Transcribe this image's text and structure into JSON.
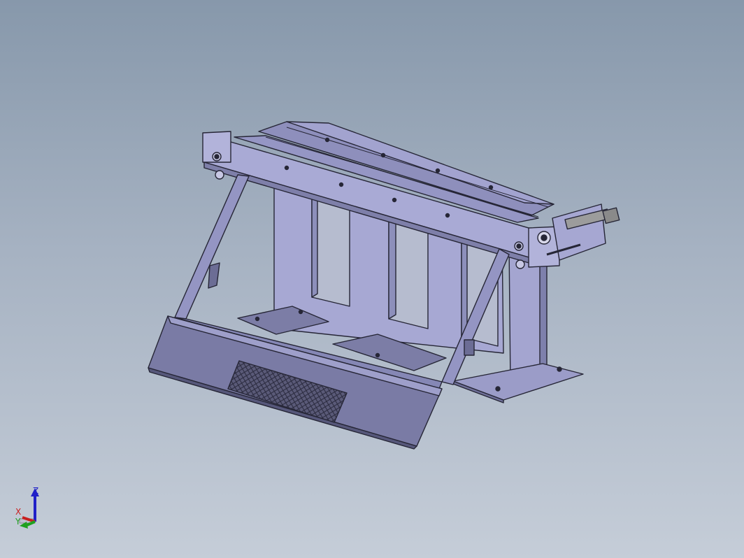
{
  "viewport": {
    "background_top": "#8798ab",
    "background_bottom": "#c5cdd8",
    "model_color": "#9fa0cc",
    "edge_color": "#262636"
  },
  "triad": {
    "z_label": "Z",
    "x_label": "X",
    "y_label": "Y",
    "z_color": "#2020c8",
    "x_color": "#c82020",
    "y_color": "#20a020"
  }
}
